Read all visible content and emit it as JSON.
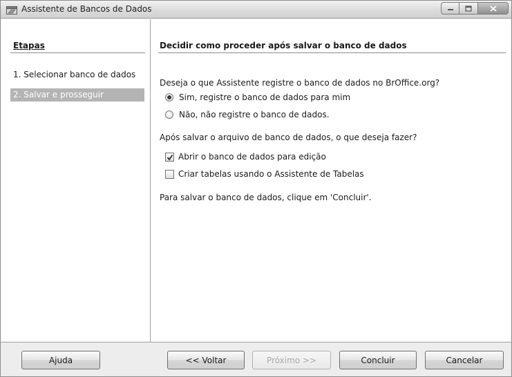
{
  "window": {
    "title": "Assistente de Bancos de Dados",
    "icon": "database-app-icon"
  },
  "steps": {
    "heading": "Etapas",
    "items": [
      {
        "label": "1. Selecionar banco de dados",
        "selected": false
      },
      {
        "label": "2. Salvar e prosseguir",
        "selected": true
      }
    ]
  },
  "main": {
    "heading": "Decidir como proceder após salvar o banco de dados",
    "register_question": "Deseja o que Assistente registre o banco de dados no BrOffice.org?",
    "register_options": [
      {
        "label": "Sim, registre o banco de dados para mim",
        "checked": true
      },
      {
        "label": "Não, não registre o banco de dados.",
        "checked": false
      }
    ],
    "after_question": "Após salvar o arquivo de banco de dados, o que deseja fazer?",
    "after_options": [
      {
        "label": "Abrir o banco de dados para edição",
        "checked": true
      },
      {
        "label": "Criar tabelas usando o Assistente de Tabelas",
        "checked": false
      }
    ],
    "note": "Para salvar o banco de dados, clique em 'Concluir'."
  },
  "buttons": {
    "help": "Ajuda",
    "back": "<< Voltar",
    "next": "Próximo >>",
    "finish": "Concluir",
    "cancel": "Cancelar"
  },
  "colors": {
    "selected_step_bg": "#b4b4b4",
    "bottom_bar_bg": "#ededed"
  }
}
